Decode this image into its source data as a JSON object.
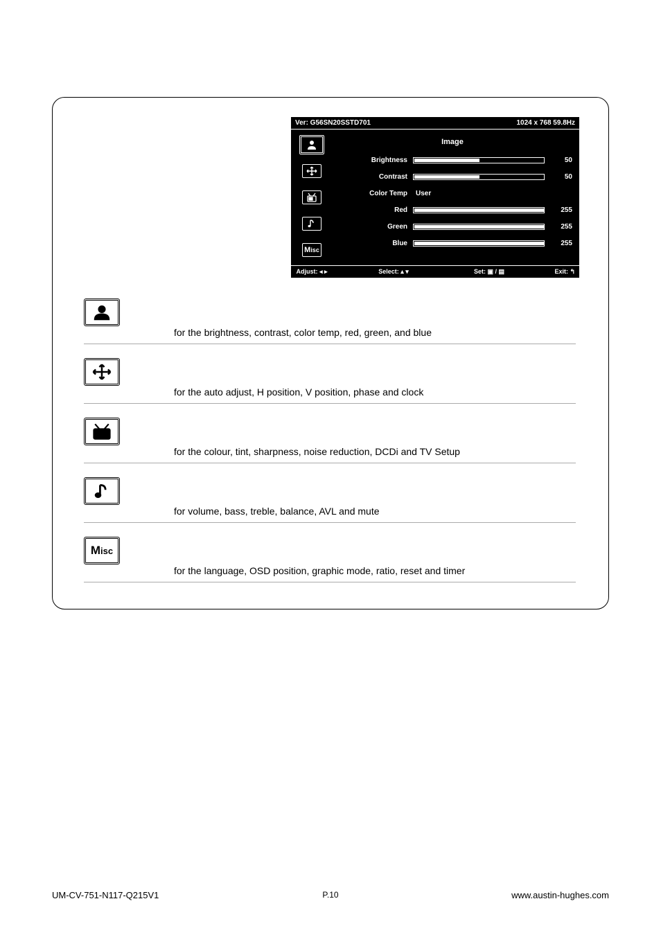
{
  "osd": {
    "version_label": "Ver: G56SN20SSTD701",
    "resolution": "1024 x 768  59.8Hz",
    "title": "Image",
    "rows": {
      "brightness": {
        "label": "Brightness",
        "value": "50",
        "fill_pct": 50
      },
      "contrast": {
        "label": "Contrast",
        "value": "50",
        "fill_pct": 50
      },
      "colortemp": {
        "label": "Color Temp",
        "text": "User"
      },
      "red": {
        "label": "Red",
        "value": "255",
        "fill_pct": 100
      },
      "green": {
        "label": "Green",
        "value": "255",
        "fill_pct": 100
      },
      "blue": {
        "label": "Blue",
        "value": "255",
        "fill_pct": 100
      }
    },
    "bottom": {
      "adjust": "Adjust: ◂ ▸",
      "select": "Select: ▴ ▾",
      "set": "Set: ▣ / ▤",
      "exit": "Exit: ↰"
    }
  },
  "descriptions": {
    "image": "for the brightness, contrast, color temp, red, green, and blue",
    "geometry": "for the auto adjust, H position, V position, phase and clock",
    "video": "for the colour, tint, sharpness, noise reduction, DCDi and TV Setup",
    "audio": "for volume, bass, treble, balance, AVL and mute",
    "misc": "for the language, OSD position, graphic mode, ratio, reset and timer"
  },
  "footer": {
    "left": "UM-CV-751-N117-Q215V1",
    "center": "P.10",
    "right": "www.austin-hughes.com"
  }
}
